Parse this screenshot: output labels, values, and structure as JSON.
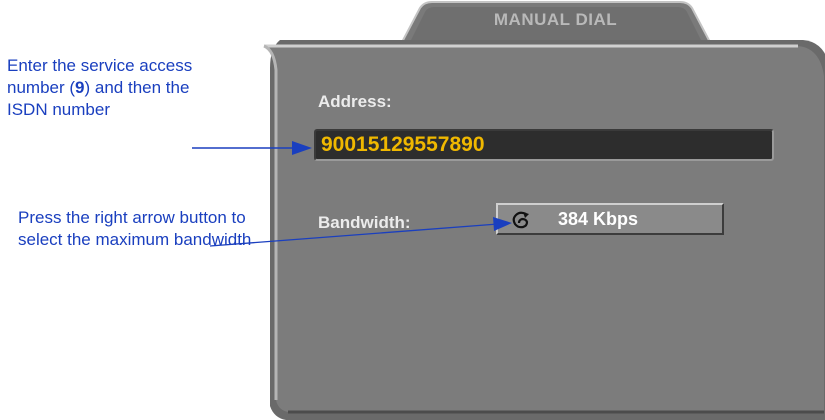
{
  "callouts": {
    "address": {
      "text_before": "Enter the service access number (",
      "bold": "9",
      "text_after": ") and then the ISDN number"
    },
    "bandwidth": {
      "text": "Press the right arrow button to select the maximum bandwidth"
    }
  },
  "dialog": {
    "tab_title": "MANUAL DIAL",
    "address_label": "Address:",
    "address_value": "90015129557890",
    "bandwidth_label": "Bandwidth:",
    "bandwidth_value": "384 Kbps",
    "bandwidth_icon": "cycle-arrow-icon"
  },
  "colors": {
    "callout_text": "#1a3fbf",
    "panel": "#7c7c7c",
    "address_value": "#f0b800",
    "address_field_bg": "#2d2d2d"
  }
}
